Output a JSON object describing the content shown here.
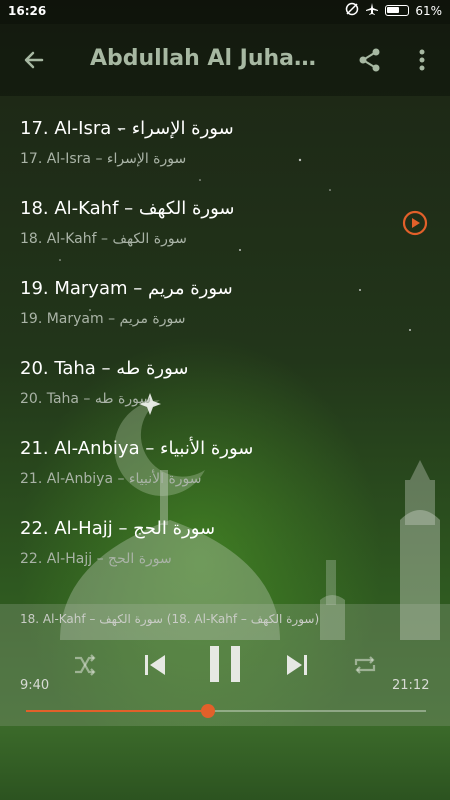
{
  "status_bar": {
    "time": "16:26",
    "battery": "61%"
  },
  "app_bar": {
    "title": "Abdullah Al Juhani..."
  },
  "tracks": [
    {
      "title": "17. Al-Isra – سورة الإسراء",
      "subtitle": "17. Al-Isra – سورة الإسراء"
    },
    {
      "title": "18. Al-Kahf – سورة الكهف",
      "subtitle": "18. Al-Kahf – سورة الكهف",
      "playing": true
    },
    {
      "title": "19. Maryam – سورة مريم",
      "subtitle": "19. Maryam – سورة مريم"
    },
    {
      "title": "20. Taha – سورة طه",
      "subtitle": "20. Taha – سورة طه"
    },
    {
      "title": "21. Al-Anbiya – سورة الأنبياء",
      "subtitle": "21. Al-Anbiya – سورة الأنبياء"
    },
    {
      "title": "22. Al-Hajj – سورة الحج",
      "subtitle": "22. Al-Hajj – سورة الحج"
    }
  ],
  "player": {
    "now_playing": "18. Al-Kahf – سورة الكهف (18. Al-Kahf – سورة الكهف)",
    "elapsed": "9:40",
    "duration": "21:12",
    "progress": 0.456
  },
  "colors": {
    "accent": "#e2602a",
    "title": "#a7b8a2"
  },
  "icons": [
    "back-arrow-icon",
    "share-icon",
    "more-vert-icon",
    "play-circle-icon",
    "shuffle-icon",
    "previous-icon",
    "pause-icon",
    "next-icon",
    "repeat-icon"
  ]
}
